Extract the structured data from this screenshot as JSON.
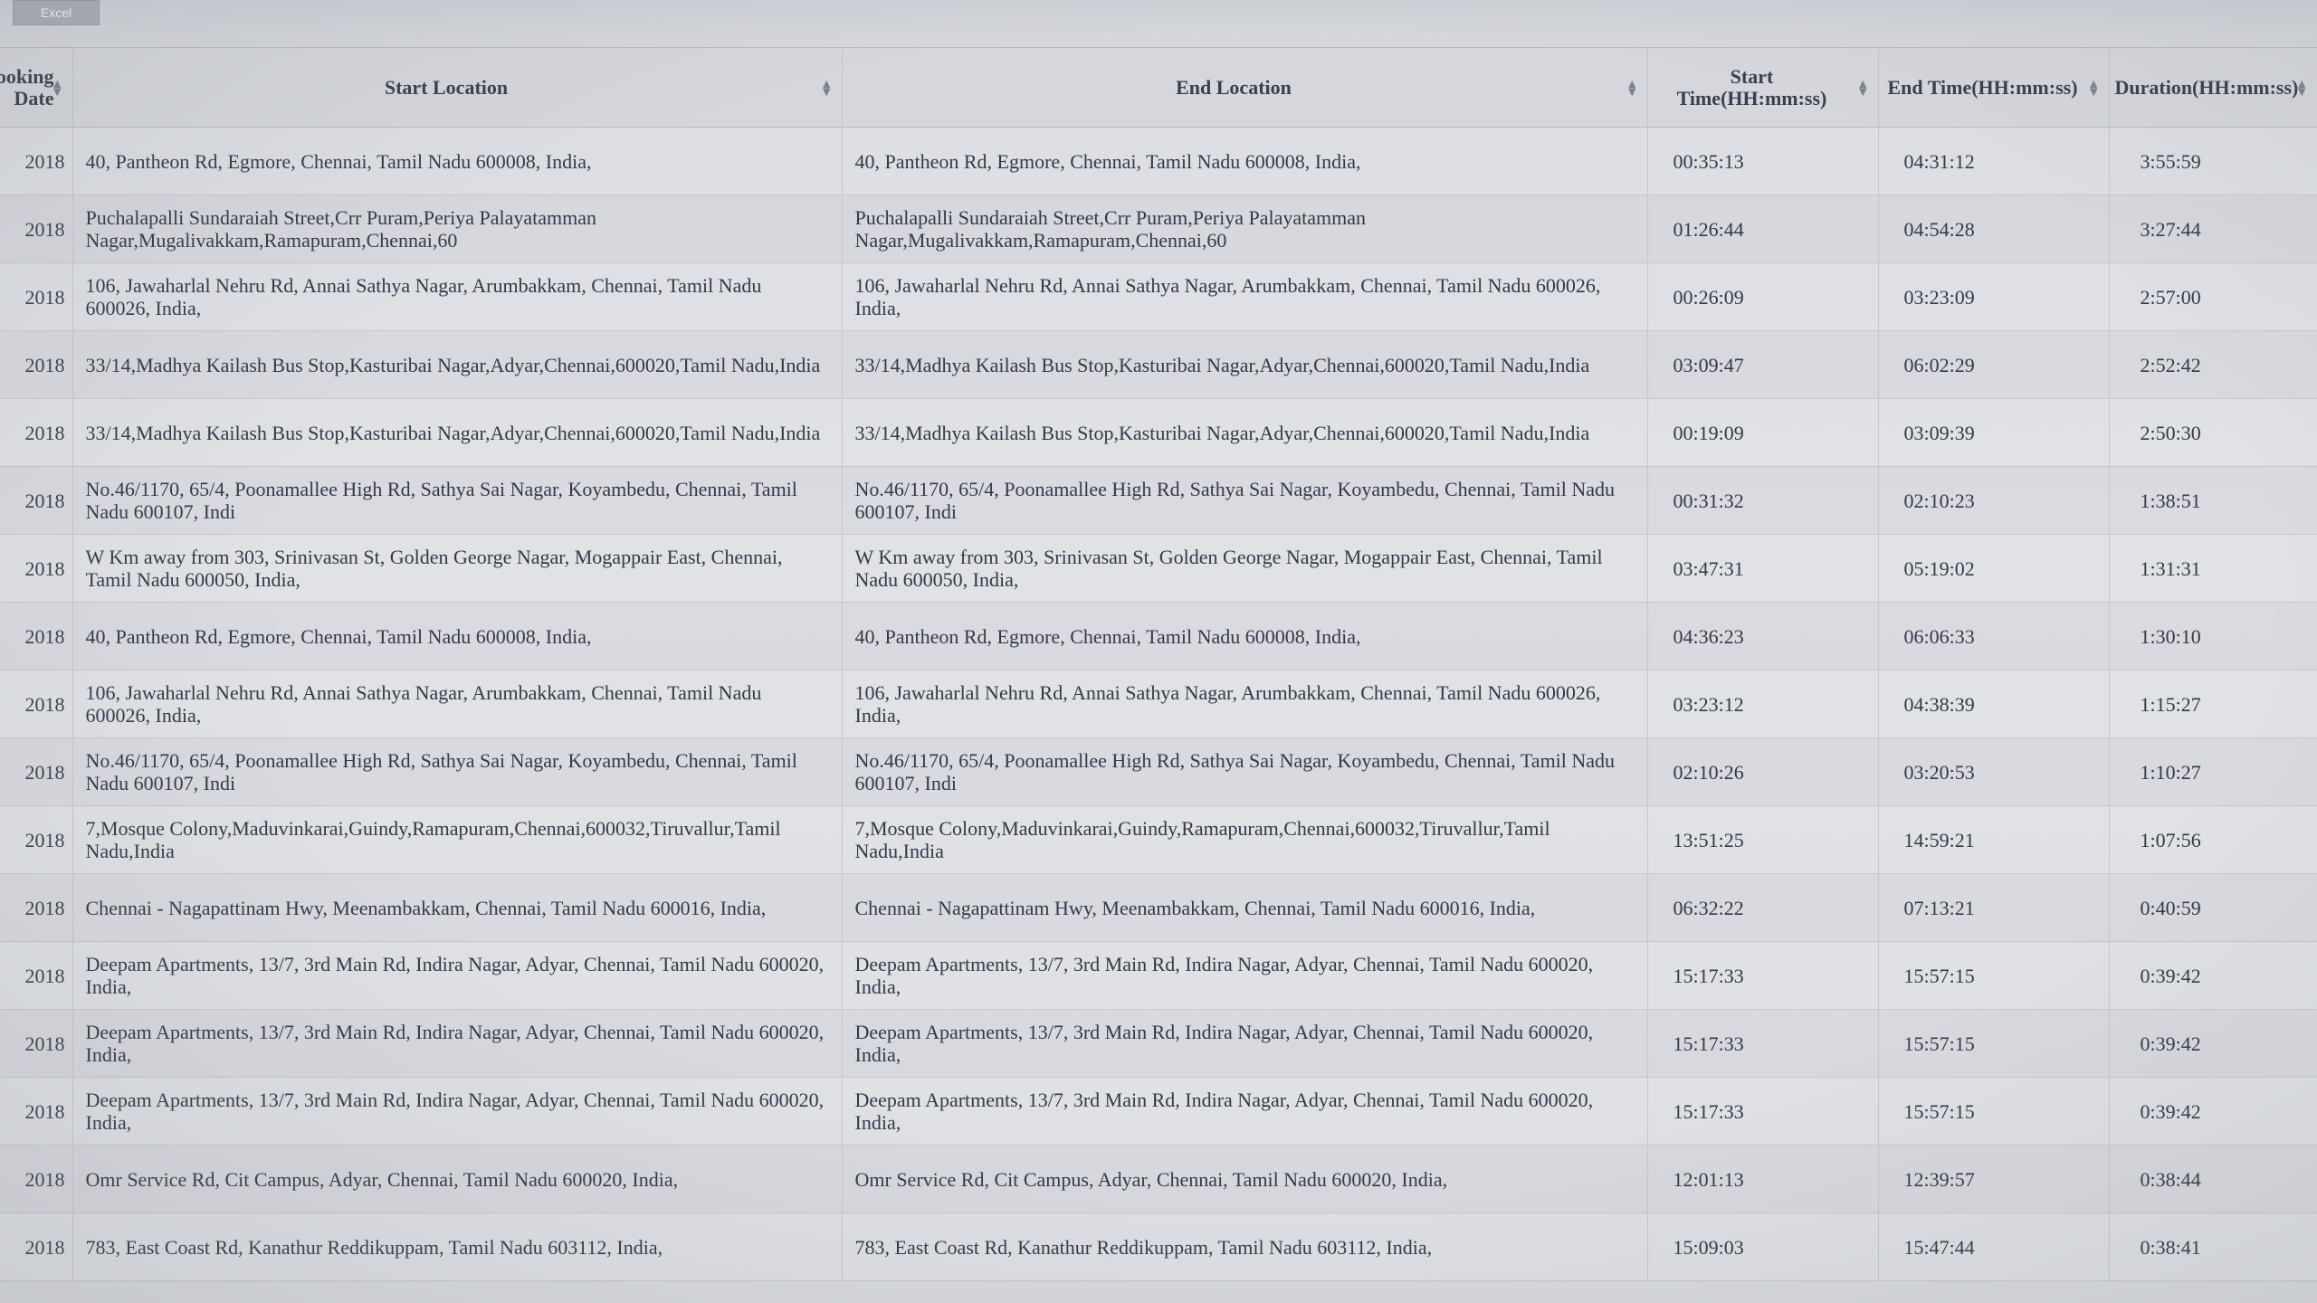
{
  "toolbar": {
    "export_label": "Excel"
  },
  "table": {
    "headers": [
      {
        "name": "header-booking-date",
        "label": "Booking Date"
      },
      {
        "name": "header-start-location",
        "label": "Start Location"
      },
      {
        "name": "header-end-location",
        "label": "End Location"
      },
      {
        "name": "header-start-time",
        "label": "Start Time(HH:mm:ss)"
      },
      {
        "name": "header-end-time",
        "label": "End Time(HH:mm:ss)"
      },
      {
        "name": "header-duration",
        "label": "Duration(HH:mm:ss)"
      }
    ],
    "rows": [
      [
        "2018",
        "40, Pantheon Rd, Egmore, Chennai, Tamil Nadu 600008, India,",
        "40, Pantheon Rd, Egmore, Chennai, Tamil Nadu 600008, India,",
        "00:35:13",
        "04:31:12",
        "3:55:59"
      ],
      [
        "2018",
        "Puchalapalli Sundaraiah Street,Crr Puram,Periya Palayatamman Nagar,Mugalivakkam,Ramapuram,Chennai,60",
        "Puchalapalli Sundaraiah Street,Crr Puram,Periya Palayatamman Nagar,Mugalivakkam,Ramapuram,Chennai,60",
        "01:26:44",
        "04:54:28",
        "3:27:44"
      ],
      [
        "2018",
        "106, Jawaharlal Nehru Rd, Annai Sathya Nagar, Arumbakkam, Chennai, Tamil Nadu 600026, India,",
        "106, Jawaharlal Nehru Rd, Annai Sathya Nagar, Arumbakkam, Chennai, Tamil Nadu 600026, India,",
        "00:26:09",
        "03:23:09",
        "2:57:00"
      ],
      [
        "2018",
        "33/14,Madhya Kailash Bus Stop,Kasturibai Nagar,Adyar,Chennai,600020,Tamil Nadu,India",
        "33/14,Madhya Kailash Bus Stop,Kasturibai Nagar,Adyar,Chennai,600020,Tamil Nadu,India",
        "03:09:47",
        "06:02:29",
        "2:52:42"
      ],
      [
        "2018",
        "33/14,Madhya Kailash Bus Stop,Kasturibai Nagar,Adyar,Chennai,600020,Tamil Nadu,India",
        "33/14,Madhya Kailash Bus Stop,Kasturibai Nagar,Adyar,Chennai,600020,Tamil Nadu,India",
        "00:19:09",
        "03:09:39",
        "2:50:30"
      ],
      [
        "2018",
        "No.46/1170, 65/4, Poonamallee High Rd, Sathya Sai Nagar, Koyambedu, Chennai, Tamil Nadu 600107, Indi",
        "No.46/1170, 65/4, Poonamallee High Rd, Sathya Sai Nagar, Koyambedu, Chennai, Tamil Nadu 600107, Indi",
        "00:31:32",
        "02:10:23",
        "1:38:51"
      ],
      [
        "2018",
        "W Km away from 303, Srinivasan St, Golden George Nagar, Mogappair East, Chennai, Tamil Nadu 600050, India,",
        "W Km away from 303, Srinivasan St, Golden George Nagar, Mogappair East, Chennai, Tamil Nadu 600050, India,",
        "03:47:31",
        "05:19:02",
        "1:31:31"
      ],
      [
        "2018",
        "40, Pantheon Rd, Egmore, Chennai, Tamil Nadu 600008, India,",
        "40, Pantheon Rd, Egmore, Chennai, Tamil Nadu 600008, India,",
        "04:36:23",
        "06:06:33",
        "1:30:10"
      ],
      [
        "2018",
        "106, Jawaharlal Nehru Rd, Annai Sathya Nagar, Arumbakkam, Chennai, Tamil Nadu 600026, India,",
        "106, Jawaharlal Nehru Rd, Annai Sathya Nagar, Arumbakkam, Chennai, Tamil Nadu 600026, India,",
        "03:23:12",
        "04:38:39",
        "1:15:27"
      ],
      [
        "2018",
        "No.46/1170, 65/4, Poonamallee High Rd, Sathya Sai Nagar, Koyambedu, Chennai, Tamil Nadu 600107, Indi",
        "No.46/1170, 65/4, Poonamallee High Rd, Sathya Sai Nagar, Koyambedu, Chennai, Tamil Nadu 600107, Indi",
        "02:10:26",
        "03:20:53",
        "1:10:27"
      ],
      [
        "2018",
        "7,Mosque Colony,Maduvinkarai,Guindy,Ramapuram,Chennai,600032,Tiruvallur,Tamil Nadu,India",
        "7,Mosque Colony,Maduvinkarai,Guindy,Ramapuram,Chennai,600032,Tiruvallur,Tamil Nadu,India",
        "13:51:25",
        "14:59:21",
        "1:07:56"
      ],
      [
        "2018",
        "Chennai - Nagapattinam Hwy, Meenambakkam, Chennai, Tamil Nadu 600016, India,",
        "Chennai - Nagapattinam Hwy, Meenambakkam, Chennai, Tamil Nadu 600016, India,",
        "06:32:22",
        "07:13:21",
        "0:40:59"
      ],
      [
        "2018",
        "Deepam Apartments, 13/7, 3rd Main Rd, Indira Nagar, Adyar, Chennai, Tamil Nadu 600020, India,",
        "Deepam Apartments, 13/7, 3rd Main Rd, Indira Nagar, Adyar, Chennai, Tamil Nadu 600020, India,",
        "15:17:33",
        "15:57:15",
        "0:39:42"
      ],
      [
        "2018",
        "Deepam Apartments, 13/7, 3rd Main Rd, Indira Nagar, Adyar, Chennai, Tamil Nadu 600020, India,",
        "Deepam Apartments, 13/7, 3rd Main Rd, Indira Nagar, Adyar, Chennai, Tamil Nadu 600020, India,",
        "15:17:33",
        "15:57:15",
        "0:39:42"
      ],
      [
        "2018",
        "Deepam Apartments, 13/7, 3rd Main Rd, Indira Nagar, Adyar, Chennai, Tamil Nadu 600020, India,",
        "Deepam Apartments, 13/7, 3rd Main Rd, Indira Nagar, Adyar, Chennai, Tamil Nadu 600020, India,",
        "15:17:33",
        "15:57:15",
        "0:39:42"
      ],
      [
        "2018",
        "Omr Service Rd, Cit Campus, Adyar, Chennai, Tamil Nadu 600020, India,",
        "Omr Service Rd, Cit Campus, Adyar, Chennai, Tamil Nadu 600020, India,",
        "12:01:13",
        "12:39:57",
        "0:38:44"
      ],
      [
        "2018",
        "783, East Coast Rd, Kanathur Reddikuppam, Tamil Nadu 603112, India,",
        "783, East Coast Rd, Kanathur Reddikuppam, Tamil Nadu 603112, India,",
        "15:09:03",
        "15:47:44",
        "0:38:41"
      ]
    ]
  }
}
